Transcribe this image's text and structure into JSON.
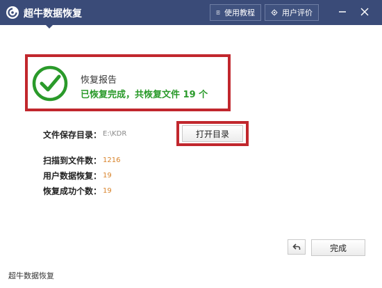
{
  "titlebar": {
    "app_title": "超牛数据恢复",
    "guide_label": "使用教程",
    "rate_label": "用户评价"
  },
  "report": {
    "title": "恢复报告",
    "summary": "已恢复完成，共恢复文件  19  个"
  },
  "details": {
    "save_dir_label": "文件保存目录：",
    "save_dir_value": "E:\\KDR",
    "open_dir_button": "打开目录",
    "scanned_label": "扫描到文件数：",
    "scanned_value": "1216",
    "user_data_label": "用户数据恢复：",
    "user_data_value": "19",
    "success_label": "恢复成功个数：",
    "success_value": "19"
  },
  "actions": {
    "done_label": "完成"
  },
  "footer": {
    "text": "超牛数据恢复"
  },
  "colors": {
    "titlebar": "#3a4b78",
    "highlight_border": "#c1272d",
    "success_green": "#2a9a2a",
    "number_orange": "#d8832a"
  },
  "icons": {
    "logo": "app-logo-icon",
    "guide": "document-icon",
    "rate": "gear-icon",
    "minimize": "minimize-icon",
    "close": "close-icon",
    "check": "check-circle-icon",
    "back": "back-arrow-icon"
  }
}
